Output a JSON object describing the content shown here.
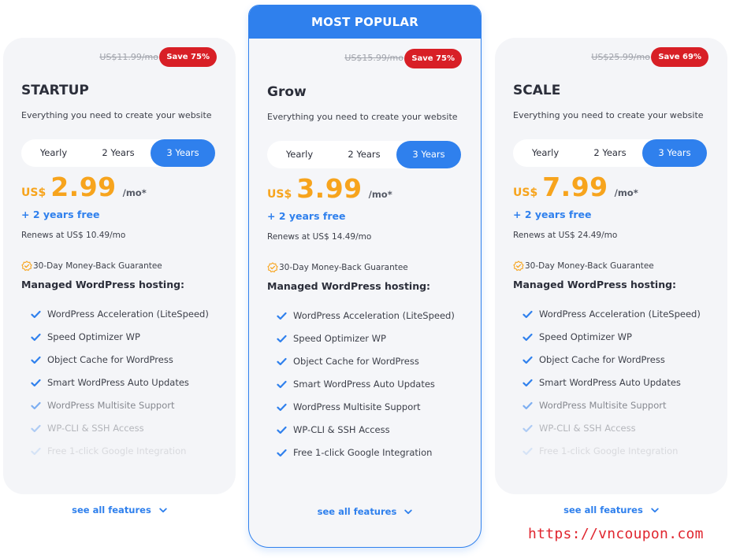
{
  "plans": [
    {
      "name": "STARTUP",
      "old_price": "US$11.99/mo",
      "save_badge": "Save 75%",
      "description": "Everything you need to create your website",
      "periods": [
        "Yearly",
        "2 Years",
        "3 Years"
      ],
      "selected_period": "3 Years",
      "currency": "US$",
      "price": "2.99",
      "per": "/mo*",
      "bonus": "+ 2 years free",
      "renews": "Renews at US$ 10.49/mo",
      "guarantee": "30-Day Money-Back Guarantee",
      "features_title": "Managed WordPress hosting:",
      "features": [
        "WordPress Acceleration (LiteSpeed)",
        "Speed Optimizer WP",
        "Object Cache for WordPress",
        "Smart WordPress Auto Updates",
        "WordPress Multisite Support",
        "WP-CLI & SSH Access",
        "Free 1-click Google Integration"
      ],
      "see_all": "see all features"
    },
    {
      "name": "Grow",
      "banner": "MOST POPULAR",
      "old_price": "US$15.99/mo",
      "save_badge": "Save 75%",
      "description": "Everything you need to create your website",
      "periods": [
        "Yearly",
        "2 Years",
        "3 Years"
      ],
      "selected_period": "3 Years",
      "currency": "US$",
      "price": "3.99",
      "per": "/mo*",
      "bonus": "+ 2 years free",
      "renews": "Renews at US$ 14.49/mo",
      "guarantee": "30-Day Money-Back Guarantee",
      "features_title": "Managed WordPress hosting:",
      "features": [
        "WordPress Acceleration (LiteSpeed)",
        "Speed Optimizer WP",
        "Object Cache for WordPress",
        "Smart WordPress Auto Updates",
        "WordPress Multisite Support",
        "WP-CLI & SSH Access",
        "Free 1-click Google Integration"
      ],
      "see_all": "see all features"
    },
    {
      "name": "SCALE",
      "old_price": "US$25.99/mo",
      "save_badge": "Save 69%",
      "description": "Everything you need to create your website",
      "periods": [
        "Yearly",
        "2 Years",
        "3 Years"
      ],
      "selected_period": "3 Years",
      "currency": "US$",
      "price": "7.99",
      "per": "/mo*",
      "bonus": "+ 2 years free",
      "renews": "Renews at US$ 24.49/mo",
      "guarantee": "30-Day Money-Back Guarantee",
      "features_title": "Managed WordPress hosting:",
      "features": [
        "WordPress Acceleration (LiteSpeed)",
        "Speed Optimizer WP",
        "Object Cache for WordPress",
        "Smart WordPress Auto Updates",
        "WordPress Multisite Support",
        "WP-CLI & SSH Access",
        "Free 1-click Google Integration"
      ],
      "see_all": "see all features"
    }
  ],
  "watermark": "https://vncoupon.com",
  "colors": {
    "accent_blue": "#2f80ed",
    "price_orange": "#f7a41d",
    "save_red": "#d81f26",
    "card_bg": "#f4f5f8"
  },
  "icons": {
    "feature": "check-icon",
    "guarantee": "shield-badge-icon",
    "see_all": "chevron-down-icon"
  }
}
